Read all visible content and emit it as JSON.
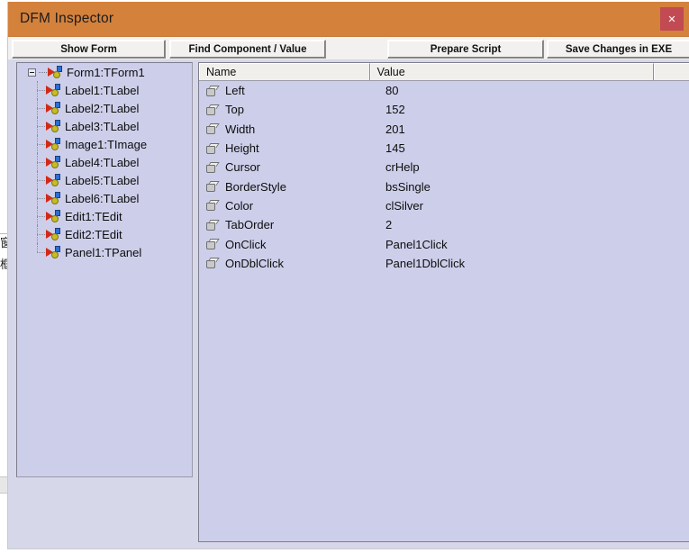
{
  "window": {
    "title": "DFM Inspector",
    "close_label": "✕",
    "titlebar_color": "#d4813c",
    "close_button_color": "#c14a53",
    "panel_background_color": "#cdcfea"
  },
  "toolbar": {
    "buttons": [
      {
        "label": "Show Form",
        "name": "show-form-button"
      },
      {
        "label": "Find Component / Value",
        "name": "find-component-value-button"
      },
      {
        "label": "Prepare Script",
        "name": "prepare-script-button"
      },
      {
        "label": "Save Changes in EXE",
        "name": "save-changes-in-exe-button"
      }
    ]
  },
  "tree": {
    "root": {
      "label": "Form1:TForm1",
      "expanded": true
    },
    "children": [
      {
        "label": "Label1:TLabel"
      },
      {
        "label": "Label2:TLabel"
      },
      {
        "label": "Label3:TLabel"
      },
      {
        "label": "Image1:TImage"
      },
      {
        "label": "Label4:TLabel"
      },
      {
        "label": "Label5:TLabel"
      },
      {
        "label": "Label6:TLabel"
      },
      {
        "label": "Edit1:TEdit"
      },
      {
        "label": "Edit2:TEdit"
      },
      {
        "label": "Panel1:TPanel"
      }
    ]
  },
  "grid": {
    "columns": [
      "Name",
      "Value",
      ""
    ],
    "rows": [
      {
        "name": "Left",
        "value": "80"
      },
      {
        "name": "Top",
        "value": "152"
      },
      {
        "name": "Width",
        "value": "201"
      },
      {
        "name": "Height",
        "value": "145"
      },
      {
        "name": "Cursor",
        "value": "crHelp"
      },
      {
        "name": "BorderStyle",
        "value": "bsSingle"
      },
      {
        "name": "Color",
        "value": "clSilver"
      },
      {
        "name": "TabOrder",
        "value": "2"
      },
      {
        "name": "OnClick",
        "value": "Panel1Click"
      },
      {
        "name": "OnDblClick",
        "value": "Panel1DblClick"
      }
    ]
  },
  "background": {
    "cjk_fragment_1": "窗",
    "cjk_fragment_2": "框"
  }
}
